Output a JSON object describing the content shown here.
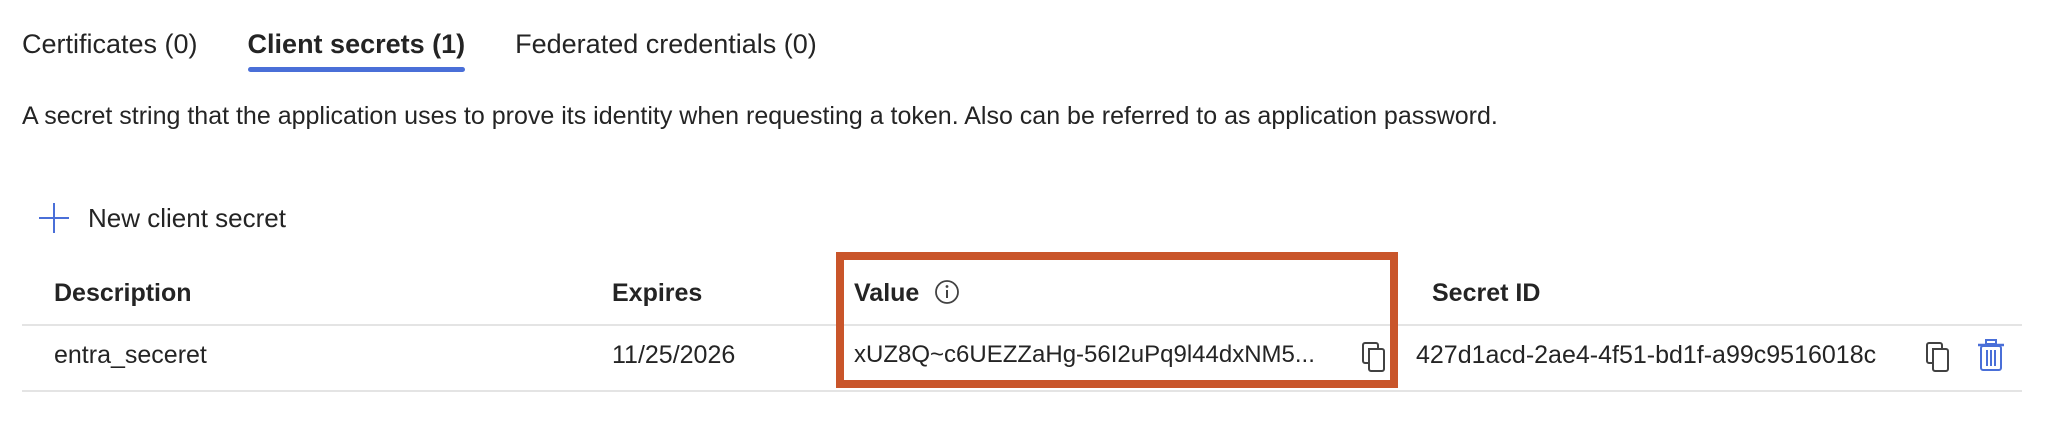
{
  "tabs": [
    {
      "label": "Certificates (0)"
    },
    {
      "label": "Client secrets (1)"
    },
    {
      "label": "Federated credentials (0)"
    }
  ],
  "description": "A secret string that the application uses to prove its identity when requesting a token. Also can be referred to as application password.",
  "toolbar": {
    "new_secret_label": "New client secret"
  },
  "table": {
    "columns": [
      "Description",
      "Expires",
      "Value",
      "Secret ID"
    ],
    "rows": [
      {
        "description": "entra_seceret",
        "expires": "11/25/2026",
        "value": "xUZ8Q~c6UEZZaHg-56I2uPq9l44dxNM5...",
        "secret_id": "427d1acd-2ae4-4f51-bd1f-a99c9516018c"
      }
    ]
  },
  "colors": {
    "accent": "#4a6fd8",
    "highlight": "#c9552a"
  },
  "icons": [
    "plus-icon",
    "info-icon",
    "copy-icon",
    "delete-icon"
  ]
}
